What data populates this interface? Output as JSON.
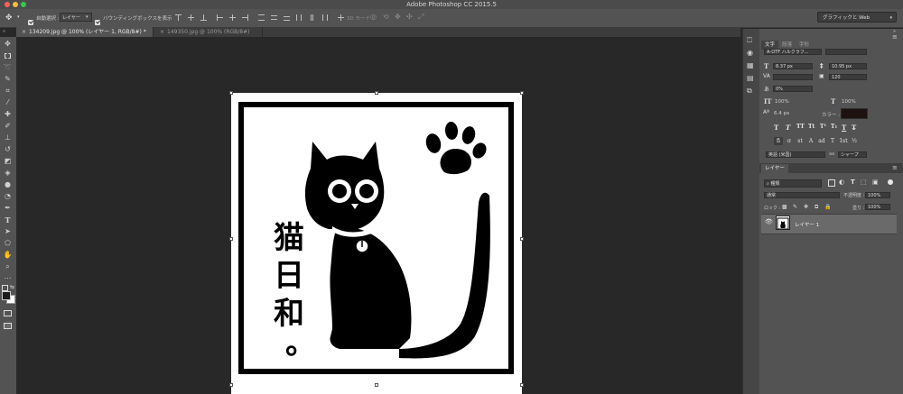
{
  "app": {
    "window_title": "Adobe Photoshop CC 2015.5",
    "traffic_light_colors": [
      "#fc605b",
      "#fdbc40",
      "#34c84a"
    ]
  },
  "options_bar": {
    "move_tool_icon": "move-tool-icon",
    "auto_select_label": "自動選択 :",
    "auto_select_checked": true,
    "target_select_value": "レイヤー",
    "transform_controls_label": "バウンディングボックスを表示",
    "transform_controls_checked": true,
    "mode_3d_label": "3D モード :",
    "workspace_select_value": "グラフィックと Web"
  },
  "tabs": [
    {
      "label": "134209.jpg @ 100% (レイヤー 1, RGB/8#) *",
      "active": true
    },
    {
      "label": "149350.jpg @ 100% (RGB/8#)",
      "active": false
    }
  ],
  "toolbar": {
    "tools": [
      "move-icon",
      "marquee-icon",
      "lasso-icon",
      "quick-select-icon",
      "crop-icon",
      "eyedropper-icon",
      "healing-brush-icon",
      "brush-icon",
      "stamp-icon",
      "history-brush-icon",
      "eraser-icon",
      "paint-bucket-icon",
      "blur-icon",
      "dodge-icon",
      "pen-icon",
      "type-icon",
      "path-select-icon",
      "shape-icon",
      "hand-icon",
      "zoom-icon",
      "more-icon"
    ],
    "foreground_color": "#1a1a1a",
    "background_color": "#ffffff"
  },
  "canvas": {
    "artwork_text": [
      "猫",
      "日",
      "和",
      "。"
    ]
  },
  "character_panel": {
    "tabs": [
      "文字",
      "段落",
      "字形"
    ],
    "font_family": "A-OTF ハルクラフ...",
    "font_size": "8.37 px",
    "leading": "10.95 px",
    "kerning": "",
    "tracking": "120",
    "tsume": "0%",
    "vertical_scale": "100%",
    "horizontal_scale": "100%",
    "baseline_shift": "6.4 px",
    "color_label": "カラー :",
    "text_color": "#1e1210",
    "type_buttons": [
      "T",
      "T",
      "TT",
      "Tt",
      "T¹",
      "T₁",
      "T",
      "T̶"
    ],
    "ot_buttons": [
      "fi",
      "σ",
      "st",
      "A",
      "ad",
      "T",
      "1st",
      "½"
    ],
    "language": "英語 (米国)",
    "antialias_icon": "aa",
    "antialias": "シャープ"
  },
  "layers_panel": {
    "tab": "レイヤー",
    "filter_kind": "種類",
    "blend_mode": "通常",
    "opacity_label": "不透明度 :",
    "opacity": "100%",
    "lock_label": "ロック :",
    "fill_label": "塗り :",
    "fill": "100%",
    "layers": [
      {
        "name": "レイヤー 1",
        "visible": true,
        "selected": true
      }
    ]
  }
}
